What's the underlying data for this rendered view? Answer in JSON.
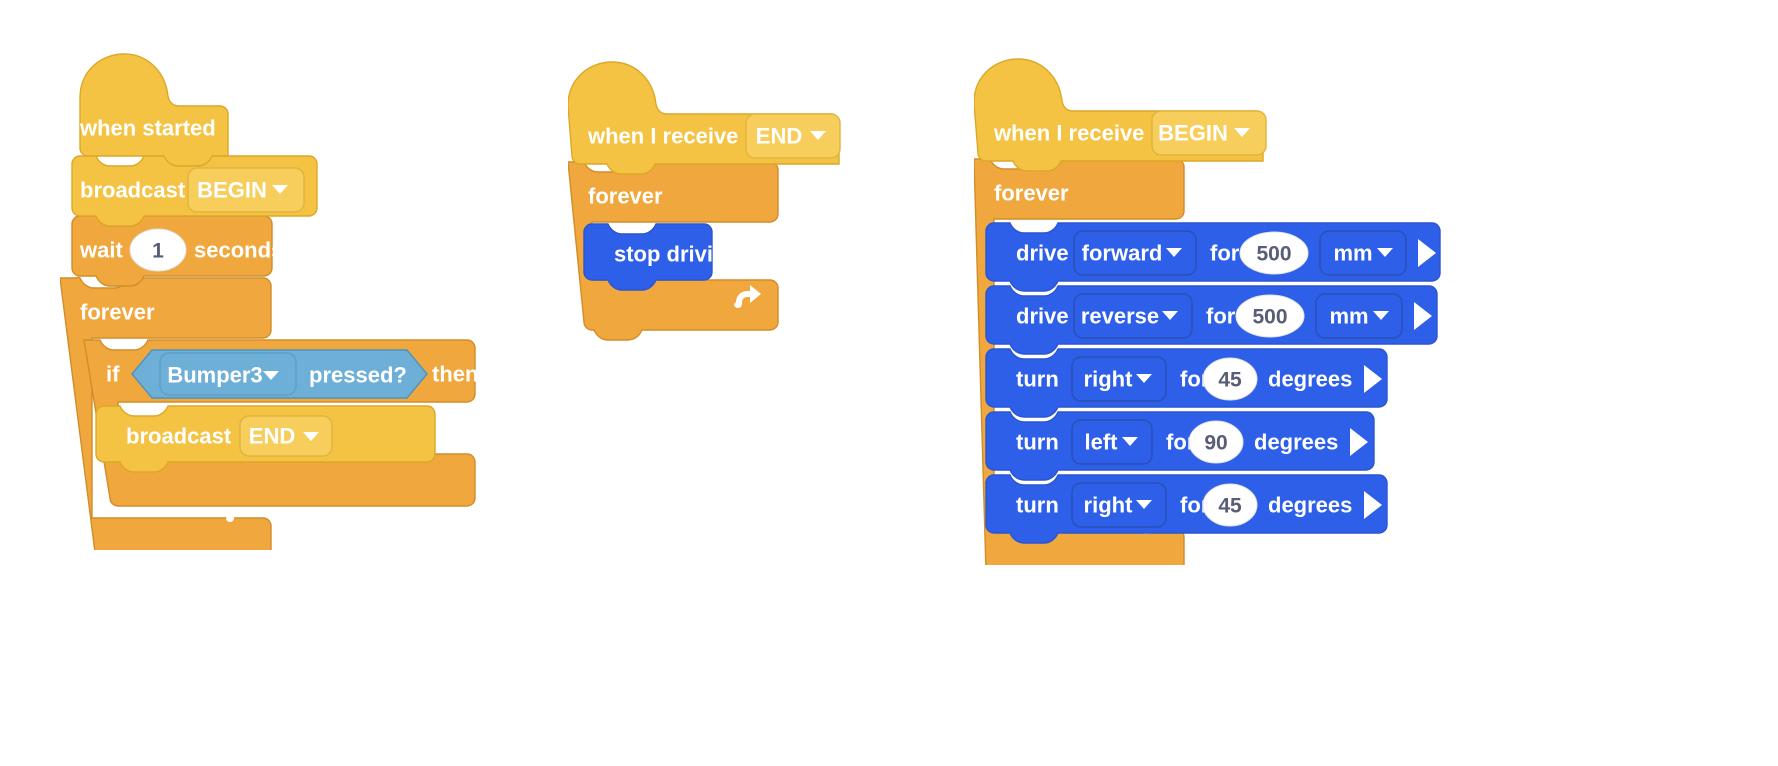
{
  "workspace": {
    "background_color": "#ffffff",
    "palette": {
      "event_yellow": "#f5c343",
      "event_yellow_stroke": "#dba827",
      "event_field": "#f7cd5c",
      "control_orange": "#f0a73e",
      "control_orange_stroke": "#d18d28",
      "drivetrain_blue": "#2e5fe8",
      "drivetrain_blue_stroke": "#3b4a63",
      "sensing_lightblue": "#6eafd8",
      "sensing_lightblue_stroke": "#4f92bd",
      "number_field_white": "#ffffff",
      "number_text": "#575e75"
    }
  },
  "stacks": [
    {
      "id": "stack-when-started",
      "name": "when-started-stack",
      "hat": {
        "label": "when started",
        "type": "event-hat"
      },
      "blocks": [
        {
          "type": "broadcast",
          "label": "broadcast",
          "dropdown": {
            "value": "BEGIN",
            "icon": "chevron-down-icon"
          }
        },
        {
          "type": "wait",
          "label_before": "wait",
          "value": "1",
          "label_after": "seconds"
        },
        {
          "type": "forever",
          "label": "forever",
          "loop_icon": "loop-arrow-icon",
          "children": [
            {
              "type": "if-then",
              "label_if": "if",
              "label_then": "then",
              "condition": {
                "type": "sensing-boolean",
                "dropdown": {
                  "value": "Bumper3",
                  "icon": "chevron-down-icon"
                },
                "label": "pressed?"
              },
              "children": [
                {
                  "type": "broadcast",
                  "label": "broadcast",
                  "dropdown": {
                    "value": "END",
                    "icon": "chevron-down-icon"
                  }
                }
              ]
            }
          ]
        }
      ]
    },
    {
      "id": "stack-when-receive-end",
      "name": "when-i-receive-end-stack",
      "hat": {
        "label": "when I receive",
        "type": "event-hat",
        "dropdown": {
          "value": "END",
          "icon": "chevron-down-icon"
        }
      },
      "blocks": [
        {
          "type": "forever",
          "label": "forever",
          "loop_icon": "loop-arrow-icon",
          "children": [
            {
              "type": "stop-driving",
              "label": "stop driving"
            }
          ]
        }
      ]
    },
    {
      "id": "stack-when-receive-begin",
      "name": "when-i-receive-begin-stack",
      "hat": {
        "label": "when I receive",
        "type": "event-hat",
        "dropdown": {
          "value": "BEGIN",
          "icon": "chevron-down-icon"
        }
      },
      "blocks": [
        {
          "type": "forever",
          "label": "forever",
          "loop_icon": "loop-arrow-icon",
          "children": [
            {
              "type": "drive",
              "label_verb": "drive",
              "direction": {
                "value": "forward",
                "icon": "chevron-down-icon"
              },
              "label_for": "for",
              "amount": "500",
              "units": {
                "value": "mm",
                "icon": "chevron-down-icon"
              },
              "run_icon": "play-triangle-icon"
            },
            {
              "type": "drive",
              "label_verb": "drive",
              "direction": {
                "value": "reverse",
                "icon": "chevron-down-icon"
              },
              "label_for": "for",
              "amount": "500",
              "units": {
                "value": "mm",
                "icon": "chevron-down-icon"
              },
              "run_icon": "play-triangle-icon"
            },
            {
              "type": "turn",
              "label_verb": "turn",
              "direction": {
                "value": "right",
                "icon": "chevron-down-icon"
              },
              "label_for": "for",
              "amount": "45",
              "units_label": "degrees",
              "run_icon": "play-triangle-icon"
            },
            {
              "type": "turn",
              "label_verb": "turn",
              "direction": {
                "value": "left",
                "icon": "chevron-down-icon"
              },
              "label_for": "for",
              "amount": "90",
              "units_label": "degrees",
              "run_icon": "play-triangle-icon"
            },
            {
              "type": "turn",
              "label_verb": "turn",
              "direction": {
                "value": "right",
                "icon": "chevron-down-icon"
              },
              "label_for": "for",
              "amount": "45",
              "units_label": "degrees",
              "run_icon": "play-triangle-icon"
            }
          ]
        }
      ]
    }
  ]
}
